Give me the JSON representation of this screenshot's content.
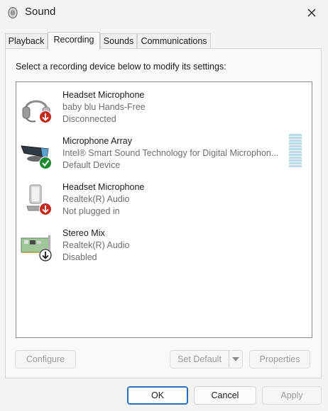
{
  "window": {
    "title": "Sound",
    "icon": "speaker-icon",
    "close_icon": "close-icon"
  },
  "tabs": [
    {
      "label": "Playback",
      "active": false
    },
    {
      "label": "Recording",
      "active": true
    },
    {
      "label": "Sounds",
      "active": false
    },
    {
      "label": "Communications",
      "active": false
    }
  ],
  "instruction": "Select a recording device below to modify its settings:",
  "devices": [
    {
      "name": "Headset Microphone",
      "description": "baby blu Hands-Free",
      "state": "Disconnected",
      "icon": "headset-icon",
      "badge": "down-arrow-red"
    },
    {
      "name": "Microphone Array",
      "description": "Intel® Smart Sound Technology for Digital Microphon...",
      "state": "Default Device",
      "icon": "microphone-array-icon",
      "badge": "checkmark-green"
    },
    {
      "name": "Headset Microphone",
      "description": "Realtek(R) Audio",
      "state": "Not plugged in",
      "icon": "microphone-icon",
      "badge": "down-arrow-red"
    },
    {
      "name": "Stereo Mix",
      "description": "Realtek(R) Audio",
      "state": "Disabled",
      "icon": "sound-card-icon",
      "badge": "down-arrow-black"
    }
  ],
  "buttons": {
    "configure": "Configure",
    "set_default": "Set Default",
    "properties": "Properties",
    "ok": "OK",
    "cancel": "Cancel",
    "apply": "Apply"
  },
  "colors": {
    "accent": "#2a6fbf",
    "badge_red": "#c42b1c",
    "badge_green": "#1e8a2e",
    "level_meter": "#bcd9ea"
  }
}
